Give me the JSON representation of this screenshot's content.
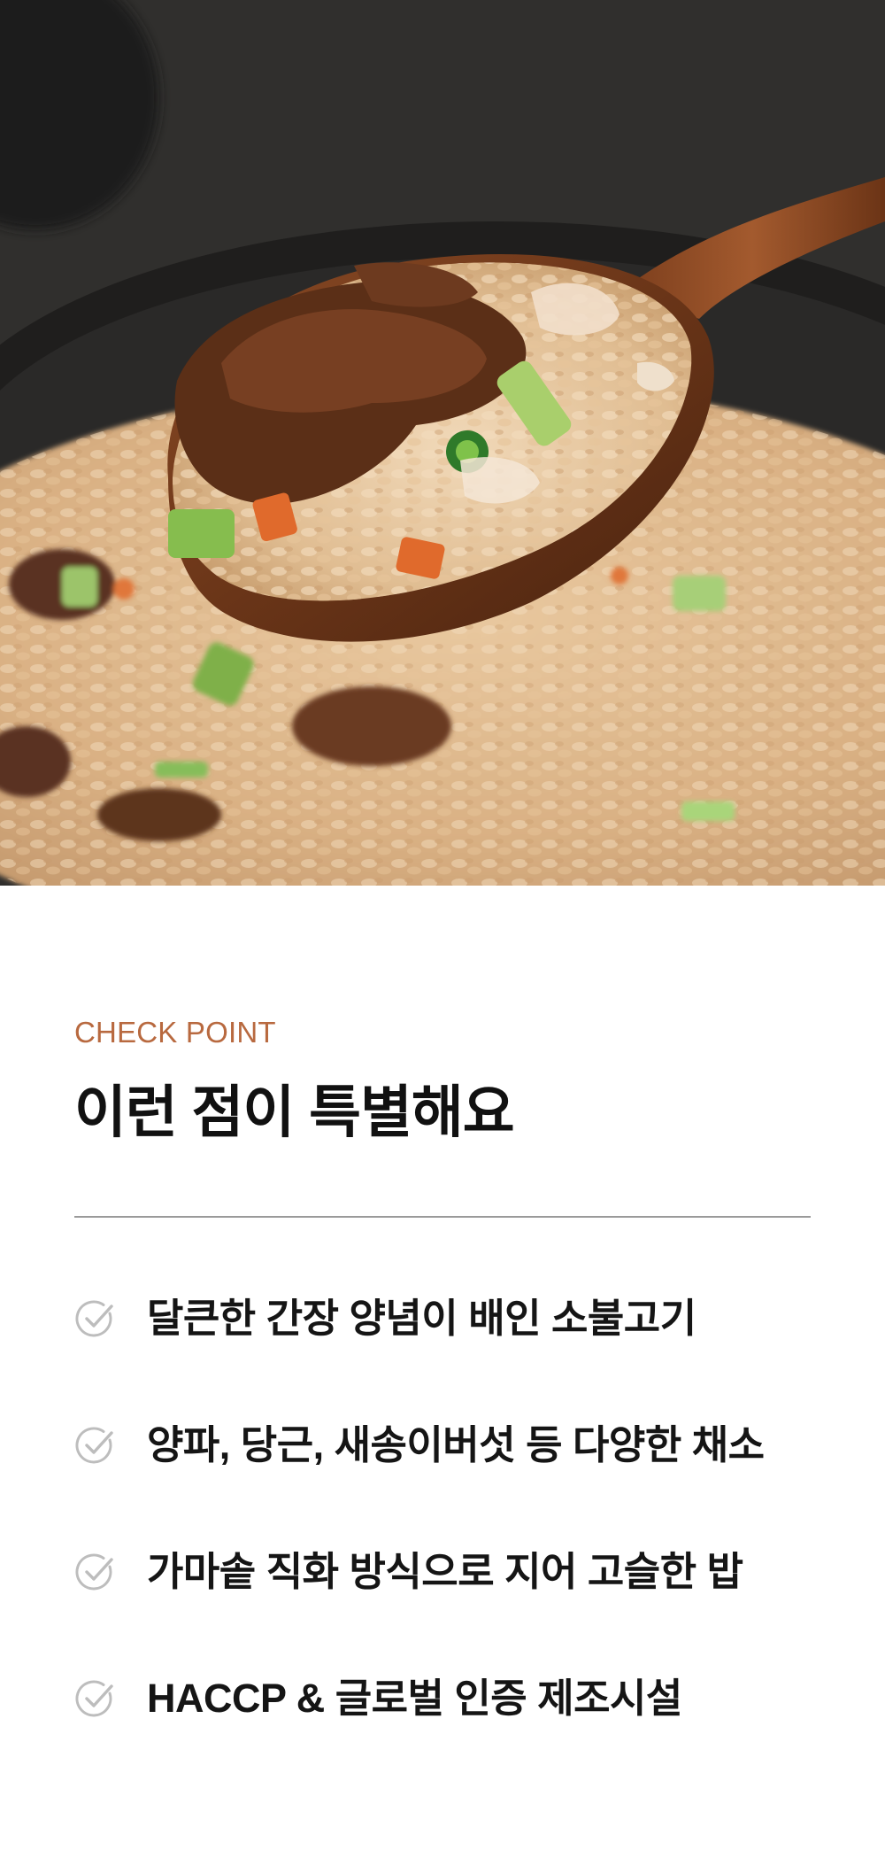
{
  "hero": {
    "image_subject": "beef bulgogi fried rice on a wooden spoon"
  },
  "section": {
    "eyebrow": "CHECK POINT",
    "title": "이런 점이 특별해요"
  },
  "checkpoints": [
    {
      "text": "달큰한 간장 양념이 배인 소불고기",
      "icon": "check-circle-icon"
    },
    {
      "text": "양파, 당근, 새송이버섯 등 다양한 채소",
      "icon": "check-circle-icon"
    },
    {
      "text": "가마솥 직화 방식으로 지어 고슬한 밥",
      "icon": "check-circle-icon"
    },
    {
      "text": "HACCP & 글로벌 인증 제조시설",
      "icon": "check-circle-icon"
    }
  ],
  "colors": {
    "accent": "#b8693f",
    "text": "#141414",
    "divider": "#9a9a9a",
    "icon": "#bdbdbd"
  }
}
